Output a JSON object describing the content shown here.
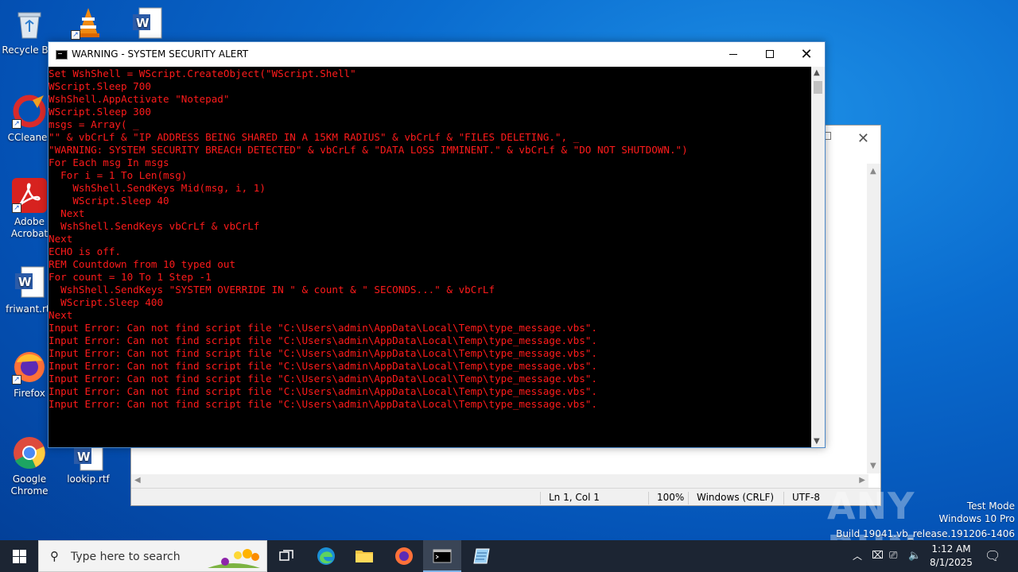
{
  "desktop": {
    "icons": [
      {
        "label": "Recycle Bin",
        "icon": "recycle-bin-icon"
      },
      {
        "label": "CCleaner",
        "icon": "ccleaner-icon"
      },
      {
        "label": "Adobe Acrobat",
        "icon": "adobe-acrobat-icon"
      },
      {
        "label": "friwant.rtf",
        "icon": "word-document-icon"
      },
      {
        "label": "Firefox",
        "icon": "firefox-icon"
      },
      {
        "label": "Google Chrome",
        "icon": "chrome-icon"
      },
      {
        "label": "lookip.rtf",
        "icon": "word-document-icon"
      }
    ]
  },
  "console": {
    "title": "WARNING - SYSTEM SECURITY ALERT",
    "text_color": "#ff1b1b",
    "lines": [
      "Set WshShell = WScript.CreateObject(\"WScript.Shell\"",
      "WScript.Sleep 700",
      "WshShell.AppActivate \"Notepad\"",
      "WScript.Sleep 300",
      "msgs = Array( _",
      "\"\" & vbCrLf & \"IP ADDRESS BEING SHARED IN A 15KM RADIUS\" & vbCrLf & \"FILES DELETING.\", _",
      "\"WARNING: SYSTEM SECURITY BREACH DETECTED\" & vbCrLf & \"DATA LOSS IMMINENT.\" & vbCrLf & \"DO NOT SHUTDOWN.\")",
      "For Each msg In msgs",
      "  For i = 1 To Len(msg)",
      "    WshShell.SendKeys Mid(msg, i, 1)",
      "    WScript.Sleep 40",
      "  Next",
      "  WshShell.SendKeys vbCrLf & vbCrLf",
      "Next",
      "ECHO is off.",
      "REM Countdown from 10 typed out",
      "For count = 10 To 1 Step -1",
      "  WshShell.SendKeys \"SYSTEM OVERRIDE IN \" & count & \" SECONDS...\" & vbCrLf",
      "  WScript.Sleep 400",
      "Next",
      "Input Error: Can not find script file \"C:\\Users\\admin\\AppData\\Local\\Temp\\type_message.vbs\".",
      "Input Error: Can not find script file \"C:\\Users\\admin\\AppData\\Local\\Temp\\type_message.vbs\".",
      "Input Error: Can not find script file \"C:\\Users\\admin\\AppData\\Local\\Temp\\type_message.vbs\".",
      "Input Error: Can not find script file \"C:\\Users\\admin\\AppData\\Local\\Temp\\type_message.vbs\".",
      "Input Error: Can not find script file \"C:\\Users\\admin\\AppData\\Local\\Temp\\type_message.vbs\".",
      "Input Error: Can not find script file \"C:\\Users\\admin\\AppData\\Local\\Temp\\type_message.vbs\".",
      "Input Error: Can not find script file \"C:\\Users\\admin\\AppData\\Local\\Temp\\type_message.vbs\"."
    ]
  },
  "notepad": {
    "status": {
      "position": "Ln 1, Col 1",
      "zoom": "100%",
      "line_ending": "Windows (CRLF)",
      "encoding": "UTF-8"
    }
  },
  "watermark": "ANY RUN",
  "system_info": {
    "mode": "Test Mode",
    "os": "Windows 10 Pro",
    "build": "Build 19041.vb_release.191206-1406"
  },
  "taskbar": {
    "search_placeholder": "Type here to search",
    "items": [
      "task-view-icon",
      "edge-icon",
      "file-explorer-icon",
      "firefox-icon",
      "command-prompt-icon",
      "notepad-icon"
    ],
    "clock_time": "1:12 AM",
    "clock_date": "8/1/2025"
  }
}
